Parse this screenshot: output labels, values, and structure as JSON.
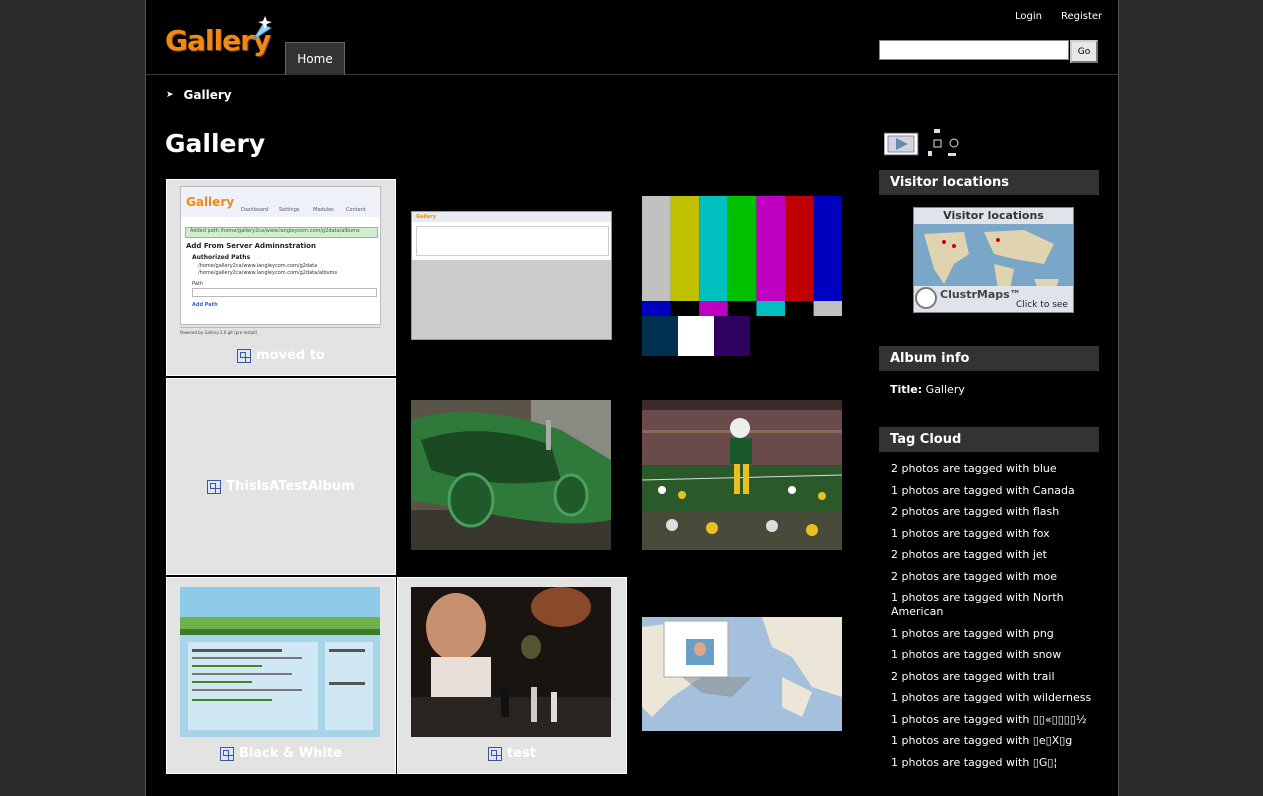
{
  "header": {
    "logo_text": "Gallery",
    "nav_home": "Home",
    "login": "Login",
    "register": "Register",
    "search_value": "",
    "search_go": "Go"
  },
  "breadcrumb": {
    "current": "Gallery"
  },
  "page_title": "Gallery",
  "albums": [
    {
      "title": "moved to",
      "type": "album"
    },
    {
      "title": "ThisIsATestAlbum",
      "type": "album"
    },
    {
      "title": "Black & White",
      "type": "album"
    },
    {
      "title": "test",
      "type": "album"
    }
  ],
  "thumb_texts": {
    "moved_heading": "Add From Server Adminnstration",
    "moved_notice": "Added path /home/gallery2ca/www.langleycom.com/g2data/albums",
    "moved_paths_heading": "Authorized Paths",
    "moved_path1": "/home/gallery2ca/www.langleycom.com/g2data",
    "moved_path2": "/home/gallery2ca/www.langleycom.com/g2data/albums",
    "moved_path_label": "Path",
    "moved_button": "Add Path",
    "moved_footer": "Powered by Gallery 2.0 git (pre-install)",
    "moved_tab1": "Dashboard",
    "moved_tab2": "Settings",
    "moved_tab3": "Modules",
    "moved_tab4": "Content"
  },
  "sidebar": {
    "visitor_title": "Visitor locations",
    "clustr_header": "Visitor locations",
    "clustr_brand": "ClustrMaps™",
    "clustr_click": "Click to see",
    "album_info_title": "Album info",
    "album_info_label": "Title:",
    "album_info_value": "Gallery",
    "tag_cloud_title": "Tag Cloud",
    "tags": [
      "2 photos are tagged with blue",
      "1 photos are tagged with Canada",
      "2 photos are tagged with flash",
      "1 photos are tagged with fox",
      "2 photos are tagged with jet",
      "2 photos are tagged with moe",
      "1 photos are tagged with North American",
      "1 photos are tagged with png",
      "1 photos are tagged with snow",
      "2 photos are tagged with trail",
      "1 photos are tagged with wilderness",
      "1 photos are tagged with ▯▯«▯▯▯▯½",
      "1 photos are tagged with ▯e▯X▯g",
      "1 photos are tagged with ▯G▯¦"
    ]
  },
  "colors": {
    "background": "#000000",
    "outer": "#2a2a2a",
    "block_header": "#333333",
    "logo_orange": "#f08a14",
    "album_cell": "#e3e3e3"
  }
}
